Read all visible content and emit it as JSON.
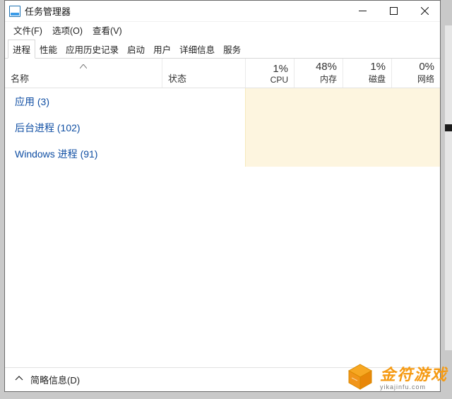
{
  "window": {
    "title": "任务管理器"
  },
  "menu": {
    "file": "文件(F)",
    "options": "选项(O)",
    "view": "查看(V)"
  },
  "tabs": {
    "processes": "进程",
    "performance": "性能",
    "app_history": "应用历史记录",
    "startup": "启动",
    "users": "用户",
    "details": "详细信息",
    "services": "服务"
  },
  "columns": {
    "name": "名称",
    "status": "状态",
    "cpu_pct": "1%",
    "cpu_lbl": "CPU",
    "mem_pct": "48%",
    "mem_lbl": "内存",
    "disk_pct": "1%",
    "disk_lbl": "磁盘",
    "net_pct": "0%",
    "net_lbl": "网络"
  },
  "groups": [
    {
      "name": "应用 (3)"
    },
    {
      "name": "后台进程 (102)"
    },
    {
      "name": "Windows 进程 (91)"
    }
  ],
  "footer": {
    "fewer_details": "简略信息(D)"
  },
  "watermark": {
    "brand": "金符游戏",
    "domain": "yikajinfu.com"
  }
}
